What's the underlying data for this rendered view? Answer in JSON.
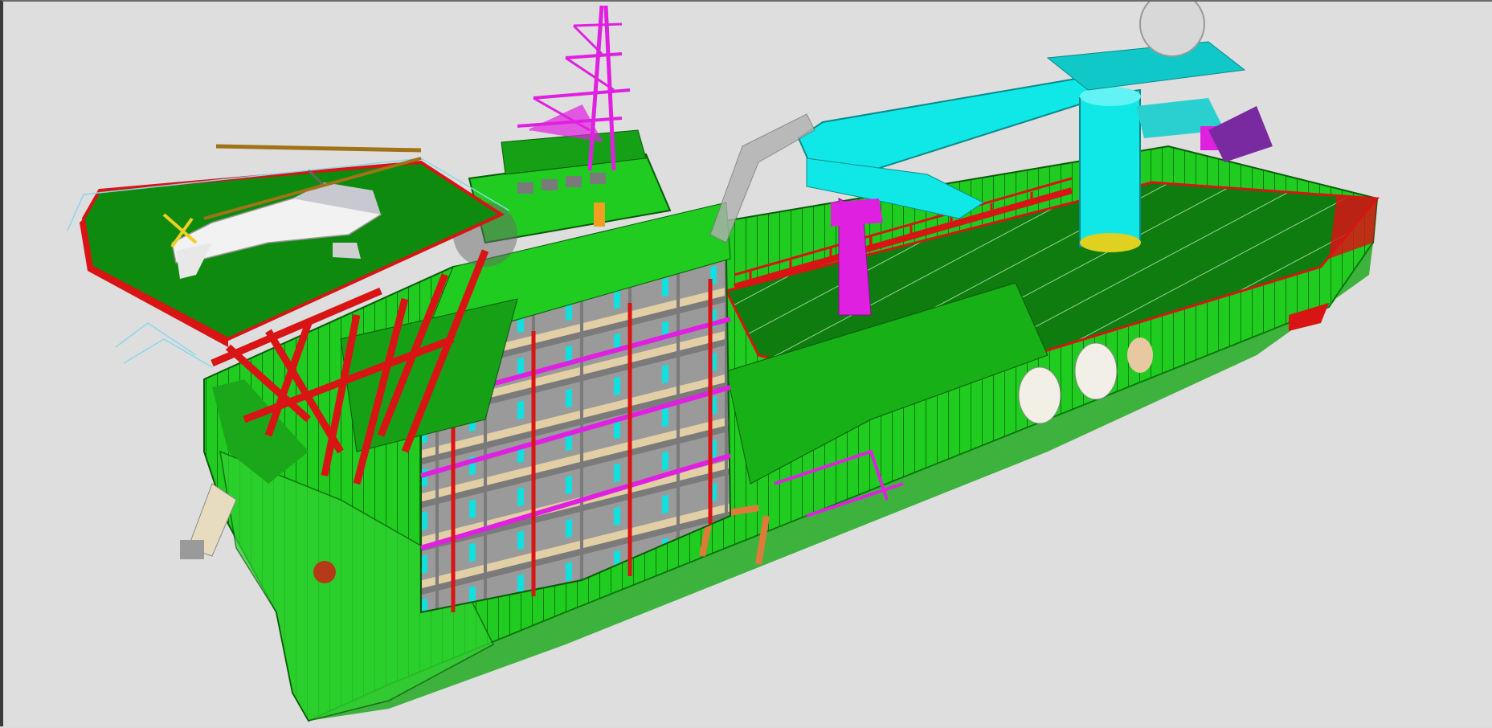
{
  "viewer": {
    "background_color": "#dedede",
    "frame_color": "#3a3a3a"
  },
  "model": {
    "subject": "ship-3d-cutaway",
    "colors": {
      "hull_green": "#19c419",
      "deck_green": "#0f8a0f",
      "structure_red": "#d81414",
      "piping_magenta": "#e020e0",
      "crane_cyan": "#10e8e8",
      "cabin_gray": "#8a8a8a",
      "cabin_floor": "#e2cfa6",
      "helicopter_white": "#f2f2f2",
      "rotor_brown": "#a0721a"
    }
  }
}
